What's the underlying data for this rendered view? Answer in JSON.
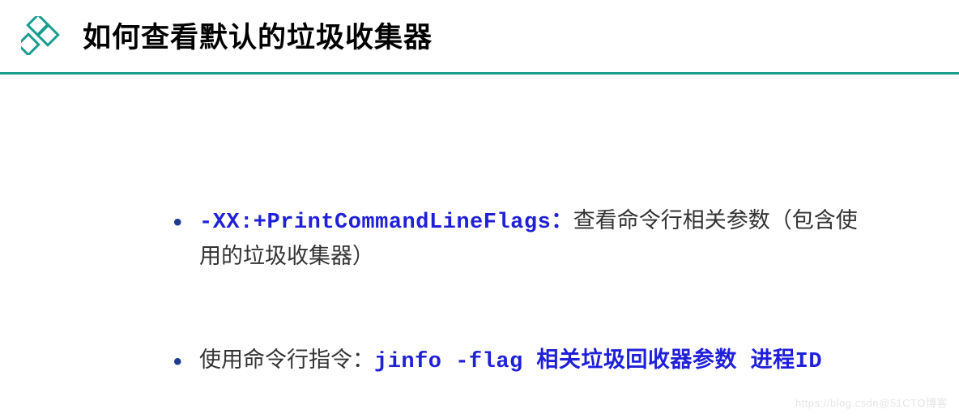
{
  "header": {
    "title": "如何查看默认的垃圾收集器"
  },
  "bullets": [
    {
      "code": "-XX:+PrintCommandLineFlags：",
      "text_after": "查看命令行相关参数（包含使用的垃圾收集器）"
    },
    {
      "text_before": "使用命令行指令：",
      "code": "jinfo -flag 相关垃圾回收器参数 进程ID"
    }
  ],
  "watermark": "https://blog.csdn@51CTO博客"
}
